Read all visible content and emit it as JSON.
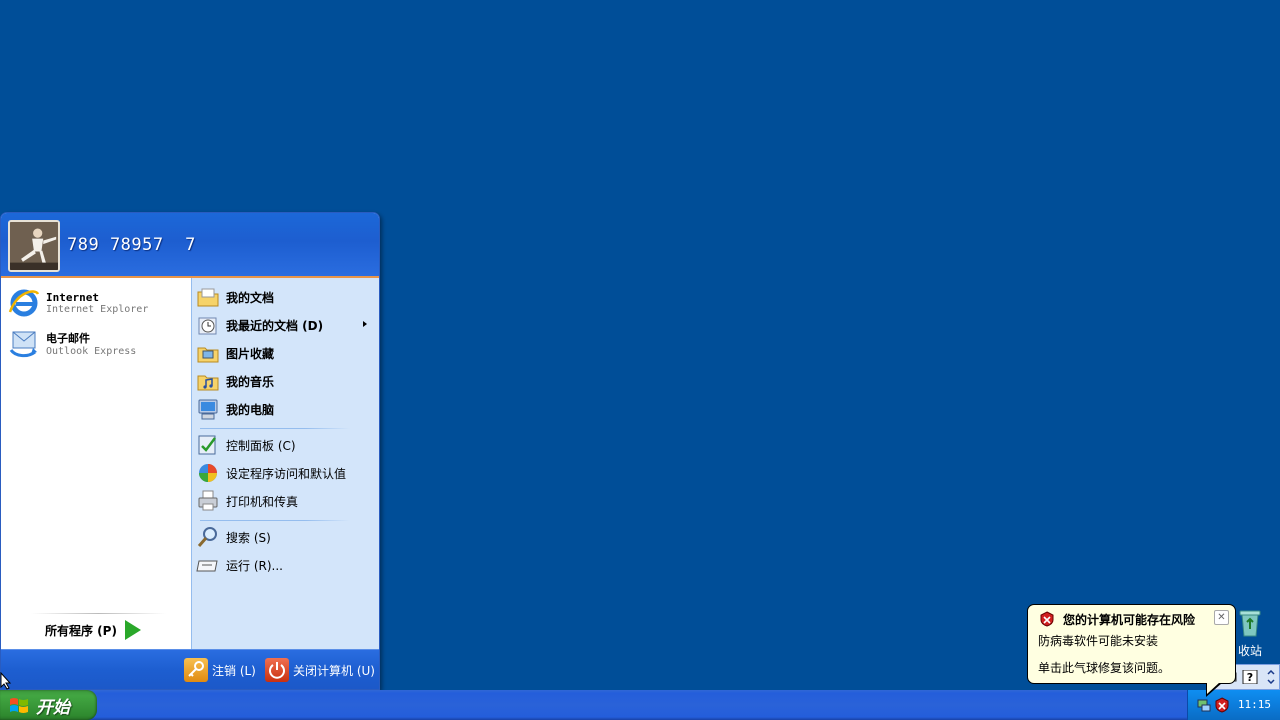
{
  "user": {
    "name": "789 78957  7"
  },
  "pinned": [
    {
      "title": "Internet",
      "subtitle": "Internet Explorer",
      "icon": "internet-explorer-icon"
    },
    {
      "title": "电子邮件",
      "subtitle": "Outlook Express",
      "icon": "outlook-express-icon"
    }
  ],
  "all_programs": {
    "label": "所有程序 (P)"
  },
  "places": [
    {
      "label": "我的文档",
      "icon": "my-documents-icon"
    },
    {
      "label": "我最近的文档 (D)",
      "icon": "recent-documents-icon"
    },
    {
      "label": "图片收藏",
      "icon": "my-pictures-icon"
    },
    {
      "label": "我的音乐",
      "icon": "my-music-icon"
    },
    {
      "label": "我的电脑",
      "icon": "my-computer-icon"
    }
  ],
  "settings": [
    {
      "label": "控制面板 (C)",
      "icon": "control-panel-icon"
    },
    {
      "label": "设定程序访问和默认值",
      "icon": "program-defaults-icon"
    },
    {
      "label": "打印机和传真",
      "icon": "printer-icon"
    }
  ],
  "tools": [
    {
      "label": "搜索 (S)",
      "icon": "search-icon"
    },
    {
      "label": "运行 (R)...",
      "icon": "run-icon"
    }
  ],
  "footer": {
    "logoff": "注销 (L)",
    "shutdown": "关闭计算机 (U)"
  },
  "taskbar": {
    "start_label": "开始",
    "clock": "11:15"
  },
  "desktop_icon": {
    "label": "收站"
  },
  "balloon": {
    "title": "您的计算机可能存在风险",
    "line1": "防病毒软件可能未安装",
    "line2": "单击此气球修复该问题。"
  },
  "colors": {
    "desktop": "#004e98",
    "start_green": "#3c9a3c",
    "menu_blue": "#1d5ed0",
    "balloon_bg": "#ffffe1"
  }
}
